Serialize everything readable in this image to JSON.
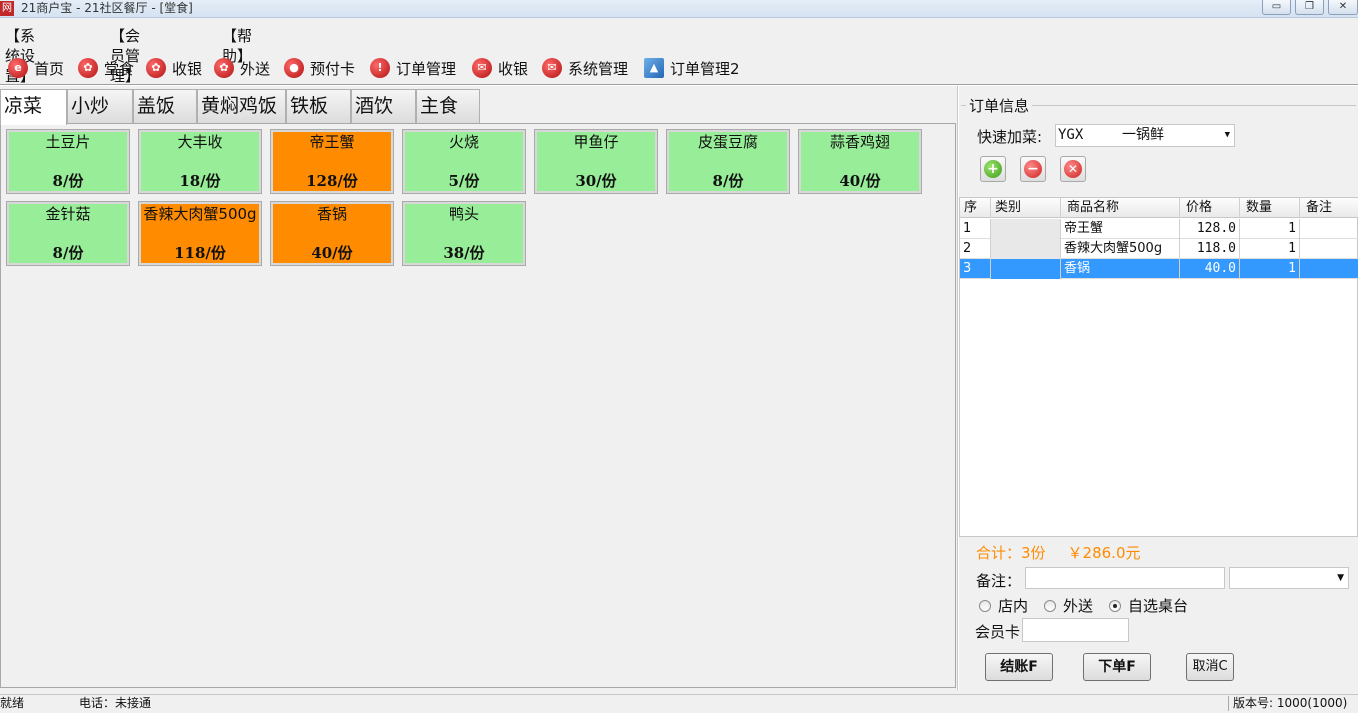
{
  "window": {
    "title": "21商户宝 - 21社区餐厅 - [堂食]",
    "icon_text": "网",
    "buttons": {
      "minimize": "▭",
      "maximize": "❐",
      "close": "✕"
    }
  },
  "menubar": [
    "【系统设置】",
    "【会员管理】",
    "【帮助】"
  ],
  "toolbar": [
    {
      "label": "首页",
      "icon": "home-icon",
      "glyph": "e"
    },
    {
      "label": "堂食",
      "icon": "dine-in-icon",
      "glyph": "✿"
    },
    {
      "label": "收银",
      "icon": "cashier-icon",
      "glyph": "✿"
    },
    {
      "label": "外送",
      "icon": "delivery-icon",
      "glyph": "✿"
    },
    {
      "label": "预付卡",
      "icon": "user-card-icon",
      "glyph": "●"
    },
    {
      "label": "订单管理",
      "icon": "info-icon",
      "glyph": "!"
    },
    {
      "label": "收银",
      "icon": "mail-icon",
      "glyph": "✉"
    },
    {
      "label": "系统管理",
      "icon": "mail-icon",
      "glyph": "✉"
    },
    {
      "label": "订单管理2",
      "icon": "picture-icon",
      "glyph": "▲"
    }
  ],
  "categories": [
    "凉菜",
    "小炒",
    "盖饭",
    "黄焖鸡饭",
    "铁板",
    "酒饮",
    "主食"
  ],
  "active_category": "凉菜",
  "dishes": [
    {
      "name": "土豆片",
      "price": "8/份",
      "color": "#98ee98"
    },
    {
      "name": "大丰收",
      "price": "18/份",
      "color": "#98ee98"
    },
    {
      "name": "帝王蟹",
      "price": "128/份",
      "color": "#ff8c00"
    },
    {
      "name": "火烧",
      "price": "5/份",
      "color": "#98ee98"
    },
    {
      "name": "甲鱼仔",
      "price": "30/份",
      "color": "#98ee98"
    },
    {
      "name": "皮蛋豆腐",
      "price": "8/份",
      "color": "#98ee98"
    },
    {
      "name": "蒜香鸡翅",
      "price": "40/份",
      "color": "#98ee98"
    },
    {
      "name": "金针菇",
      "price": "8/份",
      "color": "#98ee98"
    },
    {
      "name": "香辣大肉蟹500g",
      "price": "118/份",
      "color": "#ff8c00"
    },
    {
      "name": "香锅",
      "price": "40/份",
      "color": "#ff8c00"
    },
    {
      "name": "鸭头",
      "price": "38/份",
      "color": "#98ee98"
    }
  ],
  "order": {
    "group_title": "订单信息",
    "quick_add_label": "快速加菜:",
    "quick_add_code": "YGX",
    "quick_add_name": "一锅鲜",
    "columns": [
      "序",
      "类别",
      "商品名称",
      "价格",
      "数量",
      "备注"
    ],
    "items": [
      {
        "no": "1",
        "category": "",
        "name": "帝王蟹",
        "price": "128.0",
        "qty": "1",
        "note": ""
      },
      {
        "no": "2",
        "category": "",
        "name": "香辣大肉蟹500g",
        "price": "118.0",
        "qty": "1",
        "note": ""
      },
      {
        "no": "3",
        "category": "",
        "name": "香锅",
        "price": "40.0",
        "qty": "1",
        "note": ""
      }
    ],
    "selected_row": 3,
    "total_count": "合计：3份",
    "total_amount": "￥286.0元",
    "remark_label": "备注：",
    "remark_value": "",
    "options": [
      {
        "label": "店内",
        "checked": false
      },
      {
        "label": "外送",
        "checked": false
      },
      {
        "label": "自选桌台",
        "checked": true
      }
    ],
    "member_label": "会员卡",
    "member_value": "",
    "checkout_label": "结账F",
    "place_order_label": "下单F",
    "cancel_label": "取消C"
  },
  "statusbar": {
    "state": "就绪",
    "phone": "电话：未接通",
    "version": "版本号: 1000(1000)"
  }
}
